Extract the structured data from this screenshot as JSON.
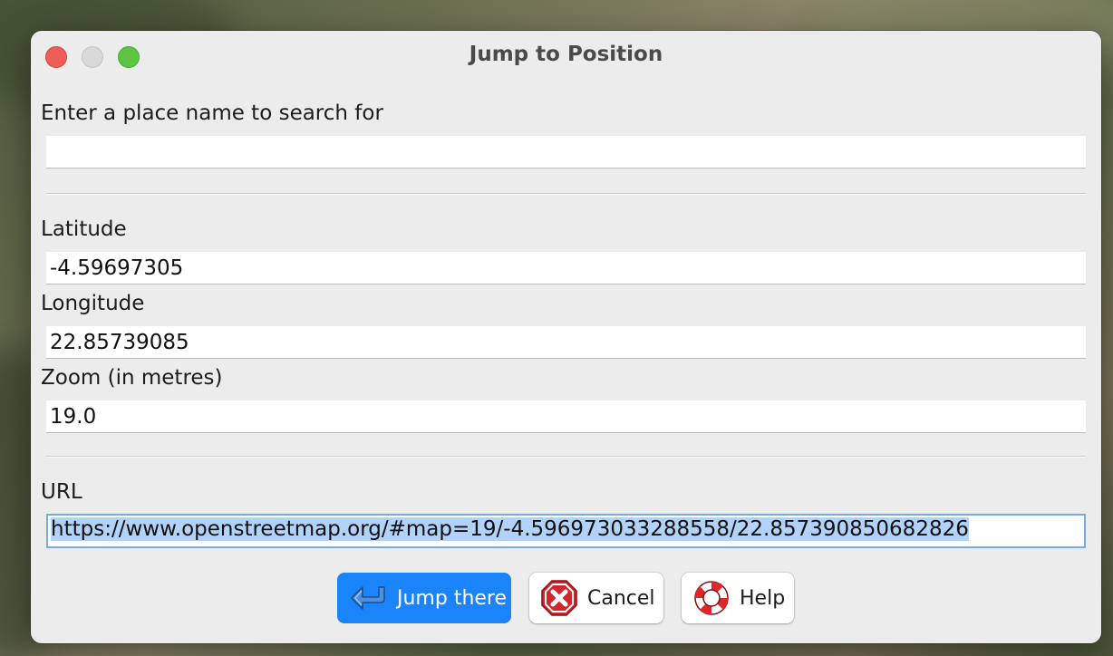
{
  "window": {
    "title": "Jump to Position"
  },
  "search": {
    "label": "Enter a place name to search for",
    "value": "",
    "placeholder": ""
  },
  "latitude": {
    "label": "Latitude",
    "value": "-4.59697305"
  },
  "longitude": {
    "label": "Longitude",
    "value": "22.85739085"
  },
  "zoom": {
    "label": "Zoom (in metres)",
    "value": "19.0"
  },
  "url": {
    "label": "URL",
    "value": "https://www.openstreetmap.org/#map=19/-4.596973033288558/22.857390850682826"
  },
  "buttons": {
    "jump_label": "Jump there",
    "cancel_label": "Cancel",
    "help_label": "Help"
  },
  "icons": {
    "jump": "arrow-left-icon",
    "cancel": "cancel-icon",
    "help": "lifebuoy-icon"
  },
  "colors": {
    "primary_button": "#1a84fb",
    "selection": "#b3d2f7"
  }
}
